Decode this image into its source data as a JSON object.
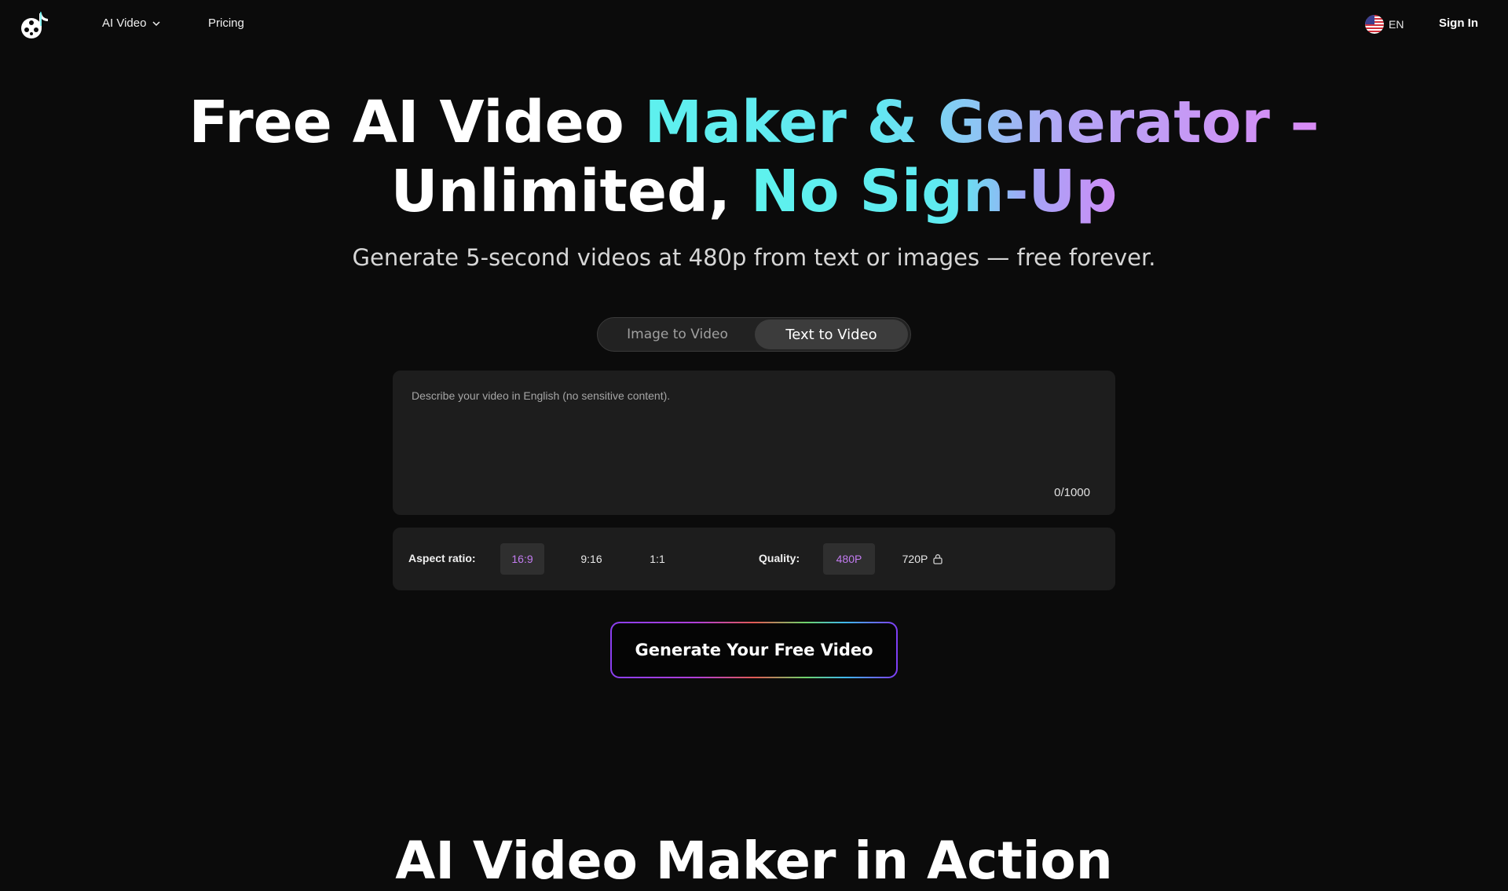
{
  "nav": {
    "menu_ai_video": "AI Video",
    "menu_pricing": "Pricing",
    "lang_code": "EN",
    "sign_in": "Sign In"
  },
  "hero": {
    "title_part1": "Free AI Video ",
    "title_part2": "Maker & Generator –",
    "title_part3": "Unlimited, ",
    "title_part4": "No Sign-Up",
    "subtitle": "Generate 5-second videos at 480p from text or images — free forever."
  },
  "mode_tabs": {
    "image_to_video": "Image to Video",
    "text_to_video": "Text to Video",
    "active": "text_to_video"
  },
  "prompt": {
    "placeholder": "Describe your video in English (no sensitive content).",
    "value": "",
    "counter": "0/1000"
  },
  "options": {
    "aspect_label": "Aspect ratio:",
    "aspect_options": [
      "16:9",
      "9:16",
      "1:1"
    ],
    "aspect_selected": "16:9",
    "quality_label": "Quality:",
    "quality_options": [
      "480P",
      "720P"
    ],
    "quality_selected": "480P",
    "quality_locked": [
      "720P"
    ]
  },
  "generate_button": "Generate Your Free Video",
  "next_section_heading": "AI Video Maker in Action",
  "colors": {
    "background": "#0b0b0b",
    "accent_purple": "#c27bf0",
    "gradient_cyan": "#5ef0ee",
    "gradient_violet": "#d98bf5"
  }
}
